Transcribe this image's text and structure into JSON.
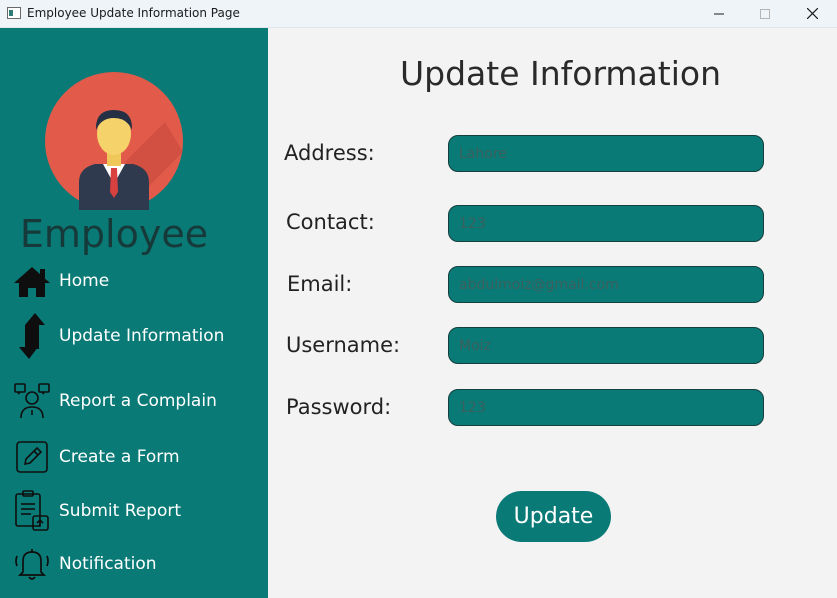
{
  "window": {
    "title": "Employee Update Information Page",
    "controls": {
      "minimize": "—",
      "maximize": "☐",
      "close": "✕"
    }
  },
  "sidebar": {
    "role_label": "Employee",
    "avatar_icon": "businessman-avatar-icon",
    "items": [
      {
        "label": "Home",
        "icon": "home-icon"
      },
      {
        "label": "Update Information",
        "icon": "update-arrows-icon"
      },
      {
        "label": "Report a Complain",
        "icon": "complaint-person-icon"
      },
      {
        "label": "Create a Form",
        "icon": "form-pencil-icon"
      },
      {
        "label": "Submit Report",
        "icon": "report-document-icon"
      },
      {
        "label": "Notification",
        "icon": "bell-icon"
      }
    ]
  },
  "main": {
    "title": "Update Information",
    "fields": {
      "address": {
        "label": "Address:",
        "value": "Lahore"
      },
      "contact": {
        "label": "Contact:",
        "value": "123"
      },
      "email": {
        "label": "Email:",
        "value": "abdulmoiz@gmail.com"
      },
      "username": {
        "label": "Username:",
        "value": "Moiz"
      },
      "password": {
        "label": "Password:",
        "value": "123"
      }
    },
    "submit_label": "Update"
  },
  "colors": {
    "teal": "#0a7a77",
    "avatar_bg": "#e25b4a",
    "page_bg": "#f3f3f3"
  }
}
